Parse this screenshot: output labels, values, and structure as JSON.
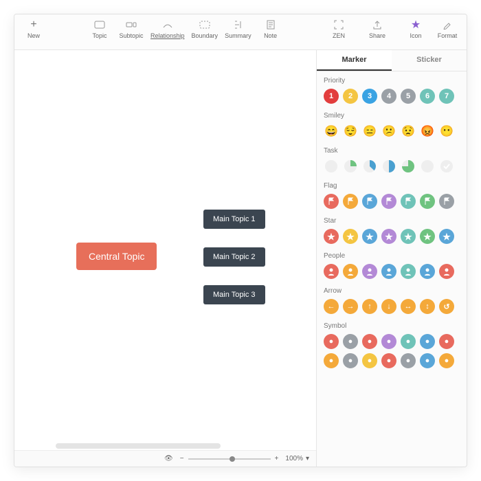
{
  "toolbar": {
    "new": "New",
    "topic": "Topic",
    "subtopic": "Subtopic",
    "relationship": "Relationship",
    "boundary": "Boundary",
    "summary": "Summary",
    "note": "Note",
    "zen": "ZEN",
    "share": "Share",
    "icon": "Icon",
    "format": "Format"
  },
  "canvas": {
    "central": "Central Topic",
    "topics": [
      "Main Topic 1",
      "Main Topic 2",
      "Main Topic 3"
    ]
  },
  "status": {
    "zoom": "100%"
  },
  "sidebar": {
    "tabs": {
      "marker": "Marker",
      "sticker": "Sticker"
    },
    "sections": {
      "priority": "Priority",
      "smiley": "Smiley",
      "task": "Task",
      "flag": "Flag",
      "star": "Star",
      "people": "People",
      "arrow": "Arrow",
      "symbol": "Symbol"
    },
    "priority": [
      {
        "n": "1",
        "c": "#e23d3d"
      },
      {
        "n": "2",
        "c": "#f4c542"
      },
      {
        "n": "3",
        "c": "#3aa3e3"
      },
      {
        "n": "4",
        "c": "#9aa0a6"
      },
      {
        "n": "5",
        "c": "#9aa0a6"
      },
      {
        "n": "6",
        "c": "#6fc3b8"
      },
      {
        "n": "7",
        "c": "#6fc3b8"
      }
    ],
    "smiley": [
      "😄",
      "😌",
      "😑",
      "😕",
      "😟",
      "😡",
      "😶"
    ],
    "task_colors": [
      "#6fc380",
      "#6fc380",
      "#4aa0d0",
      "#4aa0d0",
      "#6fc380",
      "#6fc380",
      "#6fc380"
    ],
    "flag_colors": [
      "#e86a5e",
      "#f4a93a",
      "#5aa6d8",
      "#b389d6",
      "#6fc3b8",
      "#6fc380",
      "#9aa0a6"
    ],
    "star_colors": [
      "#e86a5e",
      "#f4c542",
      "#5aa6d8",
      "#b389d6",
      "#6fc3b8",
      "#6fc380",
      "#5aa6d8"
    ],
    "people_colors": [
      "#e86a5e",
      "#f4a93a",
      "#b389d6",
      "#5aa6d8",
      "#6fc3b8",
      "#5aa6d8",
      "#e86a5e"
    ],
    "arrow_glyphs": [
      "←",
      "→",
      "↑",
      "↓",
      "↔",
      "↕",
      "↺"
    ],
    "arrow_color": "#f4a93a",
    "symbol_row1": [
      "#e86a5e",
      "#9aa0a6",
      "#e86a5e",
      "#b389d6",
      "#6fc3b8",
      "#5aa6d8",
      "#e86a5e"
    ],
    "symbol_row2": [
      "#f4a93a",
      "#9aa0a6",
      "#f4c542",
      "#e86a5e",
      "#9aa0a6",
      "#5aa6d8",
      "#f4a93a"
    ]
  }
}
